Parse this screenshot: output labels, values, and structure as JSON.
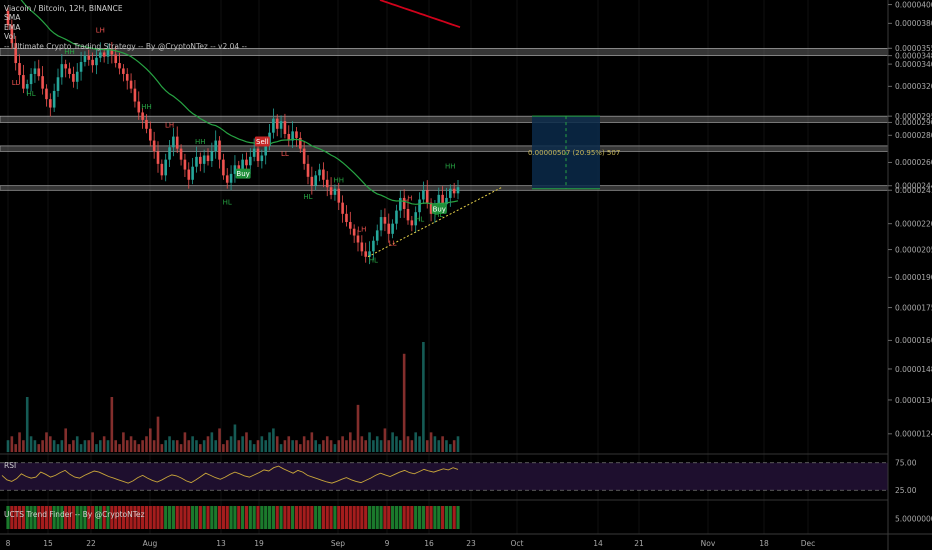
{
  "legend": {
    "symbol": "Viacoin / Bitcoin, 12H, BINANCE",
    "line2": "SMA",
    "line3": "EMA",
    "line4": "Vol",
    "strategy": "-- Ultimate Crypto Trading Strategy -- By @CryptoNTez -- v2.04 --"
  },
  "rsi_label": "RSI",
  "ucts_label": "UCTS Trend Finder -- By @CryptoNTez",
  "measure_label": "0.00000507 (20.95%) 507",
  "colors": {
    "background": "#000000",
    "up_candle": "#26a69a",
    "down_candle": "#ef5350",
    "ema_green": "#27a443",
    "sma_red": "#d0021b",
    "zone_gray": "#787878",
    "measure_box": "#0b2a4a",
    "rsi_band": "#1e0f2e",
    "rsi_line": "#c8a53a",
    "trendline": "#e8d34a"
  },
  "chart_data": {
    "type": "candlestick",
    "title": "Viacoin / Bitcoin, 12H, BINANCE",
    "x_tick_labels": [
      "8",
      "15",
      "22",
      "Aug",
      "13",
      "19",
      "Sep",
      "9",
      "16",
      "23",
      "Oct",
      "14",
      "21",
      "Nov",
      "18",
      "Dec"
    ],
    "y_tick_labels": [
      "0.00004000",
      "0.00003800",
      "0.00003550",
      "0.00003480",
      "0.00003400",
      "0.00003200",
      "0.00002950",
      "0.00002900",
      "0.00002800",
      "0.00002600",
      "0.00002440",
      "0.00002410",
      "0.00002200",
      "0.00002050",
      "0.00001900",
      "0.00001750",
      "0.00001600",
      "0.00001480",
      "0.00001360",
      "0.00001240"
    ],
    "ylim": [
      1.18e-05,
      4.05e-05
    ],
    "y_scale": "log",
    "horizontal_zones": [
      {
        "name": "resistance-3550-3480",
        "range": [
          3.48e-05,
          3.55e-05
        ]
      },
      {
        "name": "zone-2950-2900",
        "range": [
          2.9e-05,
          2.95e-05
        ]
      },
      {
        "name": "zone-2720",
        "range": [
          2.68e-05,
          2.72e-05
        ]
      },
      {
        "name": "support-2440-2410",
        "range": [
          2.41e-05,
          2.44e-05
        ]
      }
    ],
    "signals": [
      {
        "type": "Sell",
        "at": "late Aug"
      },
      {
        "type": "Buy",
        "at": "late Aug"
      },
      {
        "type": "Buy",
        "at": "mid Sep"
      }
    ],
    "swing_labels": [
      "LL",
      "HL",
      "HH",
      "LH",
      "HH",
      "LH",
      "HH",
      "HL",
      "LL",
      "HL",
      "HH",
      "LH",
      "HL",
      "LL",
      "LH",
      "HL",
      "HL",
      "HH"
    ],
    "close_series": [
      3.78e-05,
      3.6e-05,
      3.41e-05,
      3.3e-05,
      3.18e-05,
      3.22e-05,
      3.31e-05,
      3.36e-05,
      3.29e-05,
      3.18e-05,
      3.09e-05,
      3.02e-05,
      3.16e-05,
      3.28e-05,
      3.4e-05,
      3.36e-05,
      3.31e-05,
      3.24e-05,
      3.33e-05,
      3.42e-05,
      3.48e-05,
      3.44e-05,
      3.39e-05,
      3.46e-05,
      3.51e-05,
      3.47e-05,
      3.54e-05,
      3.49e-05,
      3.41e-05,
      3.36e-05,
      3.31e-05,
      3.25e-05,
      3.18e-05,
      3.07e-05,
      2.98e-05,
      2.92e-05,
      2.85e-05,
      2.76e-05,
      2.68e-05,
      2.59e-05,
      2.51e-05,
      2.62e-05,
      2.71e-05,
      2.79e-05,
      2.7e-05,
      2.62e-05,
      2.55e-05,
      2.48e-05,
      2.57e-05,
      2.64e-05,
      2.59e-05,
      2.65e-05,
      2.61e-05,
      2.68e-05,
      2.76e-05,
      2.62e-05,
      2.51e-05,
      2.46e-05,
      2.52e-05,
      2.58e-05,
      2.55e-05,
      2.62e-05,
      2.58e-05,
      2.64e-05,
      2.7e-05,
      2.61e-05,
      2.65e-05,
      2.72e-05,
      2.82e-05,
      2.93e-05,
      2.85e-05,
      2.91e-05,
      2.81e-05,
      2.76e-05,
      2.83e-05,
      2.78e-05,
      2.7e-05,
      2.59e-05,
      2.5e-05,
      2.44e-05,
      2.51e-05,
      2.55e-05,
      2.48e-05,
      2.43e-05,
      2.38e-05,
      2.42e-05,
      2.33e-05,
      2.26e-05,
      2.21e-05,
      2.17e-05,
      2.13e-05,
      2.09e-05,
      2.04e-05,
      2.01e-05,
      2.04e-05,
      2.1e-05,
      2.16e-05,
      2.24e-05,
      2.2e-05,
      2.14e-05,
      2.2e-05,
      2.28e-05,
      2.36e-05,
      2.29e-05,
      2.22e-05,
      2.19e-05,
      2.27e-05,
      2.35e-05,
      2.41e-05,
      2.33e-05,
      2.26e-05,
      2.31e-05,
      2.38e-05,
      2.32e-05,
      2.36e-05,
      2.42e-05,
      2.39e-05,
      2.43e-05
    ],
    "volume_series": [
      3,
      4,
      2,
      5,
      3,
      14,
      4,
      3,
      2,
      3,
      5,
      4,
      3,
      2,
      3,
      6,
      2,
      3,
      4,
      2,
      3,
      3,
      5,
      2,
      3,
      4,
      3,
      14,
      3,
      2,
      5,
      3,
      4,
      3,
      2,
      3,
      4,
      6,
      3,
      9,
      2,
      3,
      4,
      3,
      3,
      2,
      5,
      3,
      4,
      3,
      2,
      3,
      4,
      5,
      3,
      6,
      2,
      3,
      4,
      7,
      3,
      4,
      5,
      3,
      2,
      3,
      4,
      3,
      5,
      6,
      4,
      2,
      3,
      4,
      3,
      3,
      2,
      4,
      3,
      5,
      3,
      2,
      3,
      4,
      3,
      2,
      3,
      4,
      3,
      5,
      3,
      12,
      4,
      3,
      5,
      3,
      4,
      3,
      6,
      3,
      5,
      4,
      3,
      25,
      4,
      3,
      5,
      4,
      28,
      3,
      5,
      4,
      3,
      4,
      3,
      2,
      3,
      4,
      3,
      3
    ],
    "rsi_series": [
      52,
      44,
      41,
      46,
      55,
      50,
      47,
      49,
      58,
      54,
      49,
      52,
      57,
      61,
      54,
      49,
      47,
      52,
      56,
      60,
      58,
      54,
      50,
      47,
      44,
      41,
      38,
      42,
      48,
      52,
      47,
      43,
      40,
      44,
      49,
      53,
      51,
      47,
      42,
      39,
      44,
      50,
      56,
      52,
      48,
      45,
      49,
      54,
      58,
      55,
      51,
      49,
      53,
      57,
      62,
      60,
      66,
      69,
      64,
      60,
      56,
      61,
      58,
      52,
      49,
      46,
      43,
      40,
      38,
      41,
      45,
      48,
      44,
      41,
      39,
      43,
      47,
      52,
      56,
      53,
      50,
      54,
      58,
      61,
      57,
      55,
      59,
      63,
      60,
      58,
      61,
      64,
      62,
      66,
      63
    ],
    "rsi_levels": [
      "75.00",
      "25.00"
    ],
    "ucts_level": "5.00000000"
  }
}
